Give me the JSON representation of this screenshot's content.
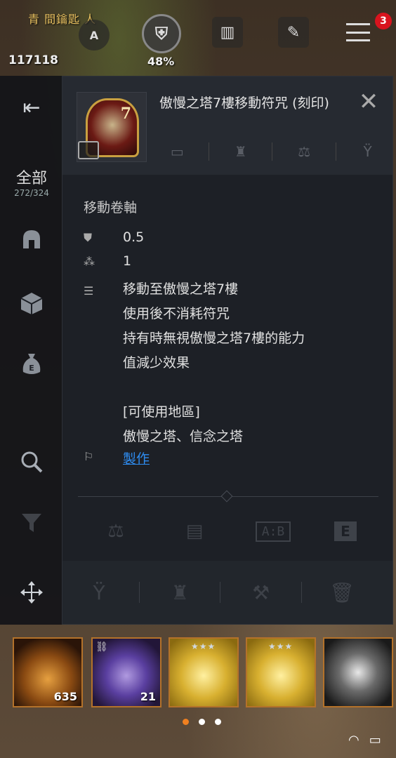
{
  "hud": {
    "player_name": "青 間鑰匙 人",
    "gold": "117118",
    "auto_label": "A",
    "shield_percent": "48%",
    "menu_badge": "3"
  },
  "rail": {
    "back_icon": "collapse-arrow-icon",
    "all_label": "全部",
    "all_count": "272/324"
  },
  "item": {
    "title": "傲慢之塔7樓移動符咒 (刻印)",
    "icon_number": "7",
    "category": "移動卷軸",
    "weight": "0.5",
    "count": "1",
    "description": [
      "移動至傲慢之塔7樓",
      "使用後不消耗符咒",
      "持有時無視傲慢之塔7樓的能力",
      "值減少效果",
      "",
      "[可使用地區]",
      "傲慢之塔、信念之塔"
    ],
    "craft_link": "製作"
  },
  "tools": {
    "ab_label": "A:B",
    "e_label": "E"
  },
  "slots": [
    {
      "name": "potion",
      "count": "635"
    },
    {
      "name": "purple-gem",
      "count": "21"
    },
    {
      "name": "gold-emblem",
      "stars": "★★★"
    },
    {
      "name": "gold-emblem",
      "stars": "★★★"
    },
    {
      "name": "vortex-scroll"
    }
  ],
  "colors": {
    "accent": "#f08020",
    "link": "#2e8cf0",
    "badge": "#d8141e",
    "slot_border": "#b4722a"
  }
}
